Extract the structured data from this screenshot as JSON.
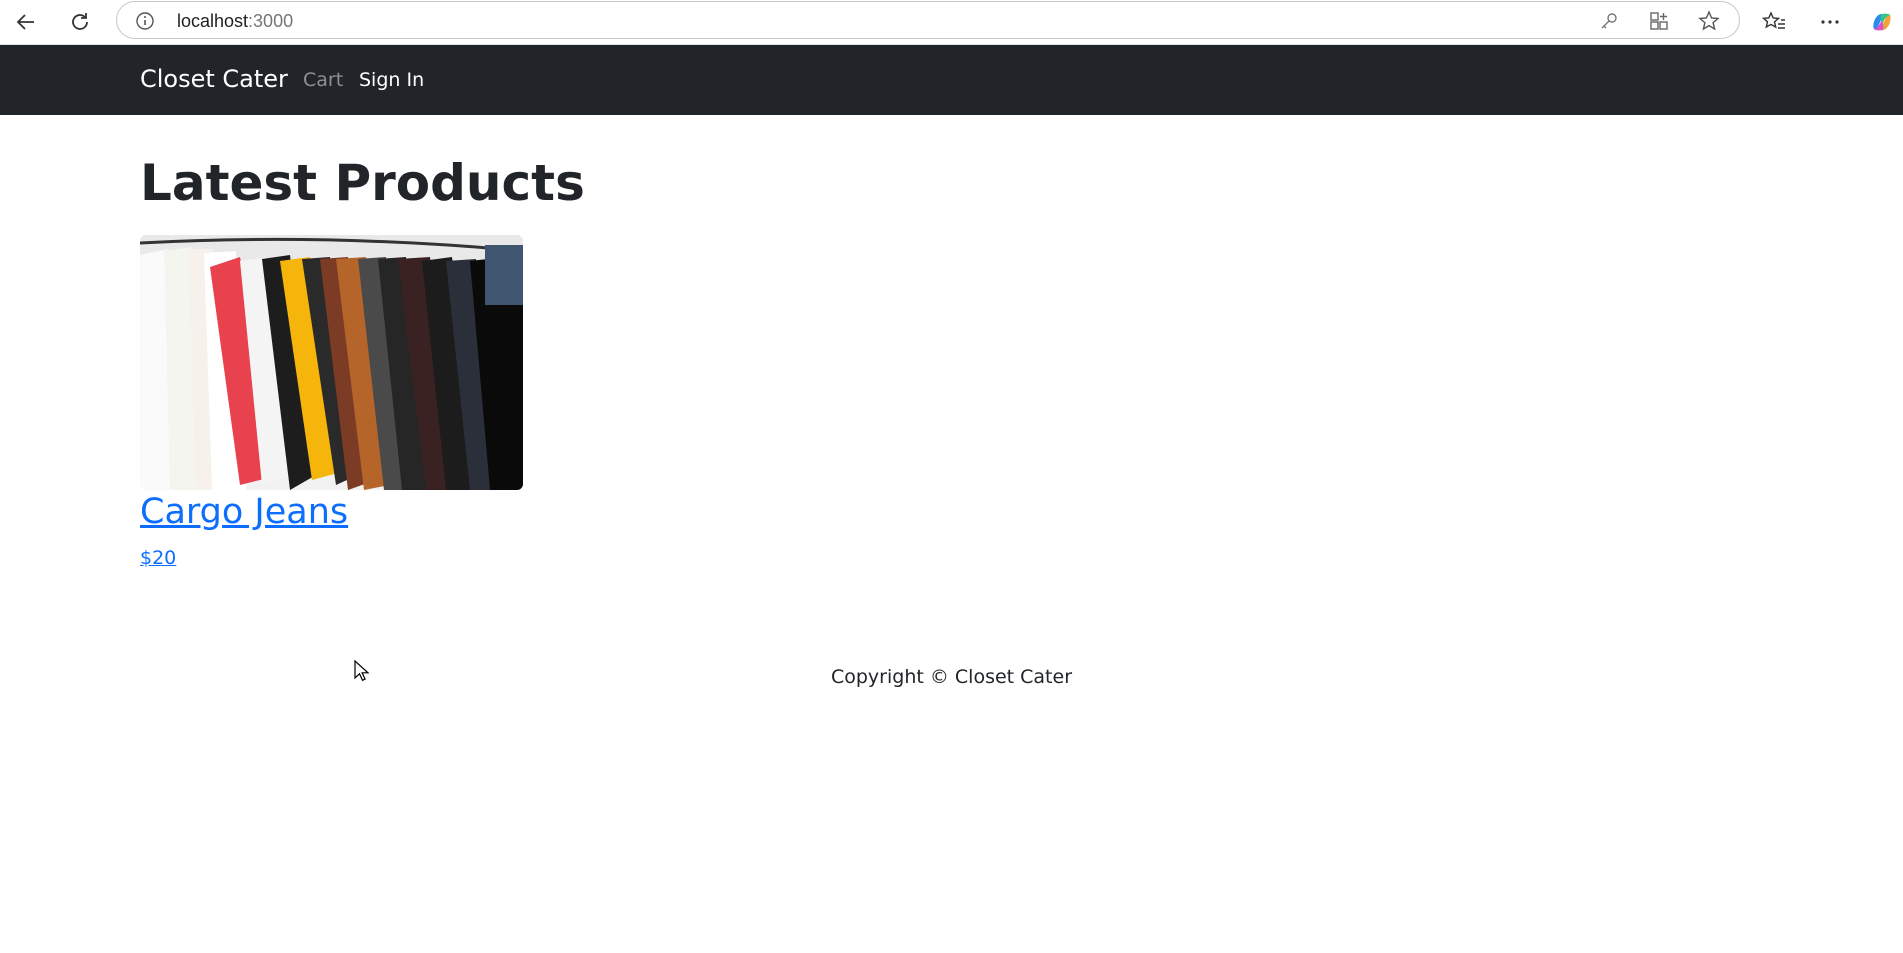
{
  "browser": {
    "url_host": "localhost",
    "url_port": ":3000"
  },
  "navbar": {
    "brand": "Closet Cater",
    "links": [
      {
        "label": "Cart"
      },
      {
        "label": "Sign In"
      }
    ]
  },
  "main": {
    "title": "Latest Products",
    "products": [
      {
        "name": "Cargo Jeans",
        "price": "$20",
        "image_icon": "clothing-rack-photo"
      }
    ]
  },
  "footer": {
    "text": "Copyright © Closet Cater"
  },
  "colors": {
    "navbar_bg": "#212529",
    "link": "#0d6efd",
    "nav_muted": "#8c8f93"
  }
}
